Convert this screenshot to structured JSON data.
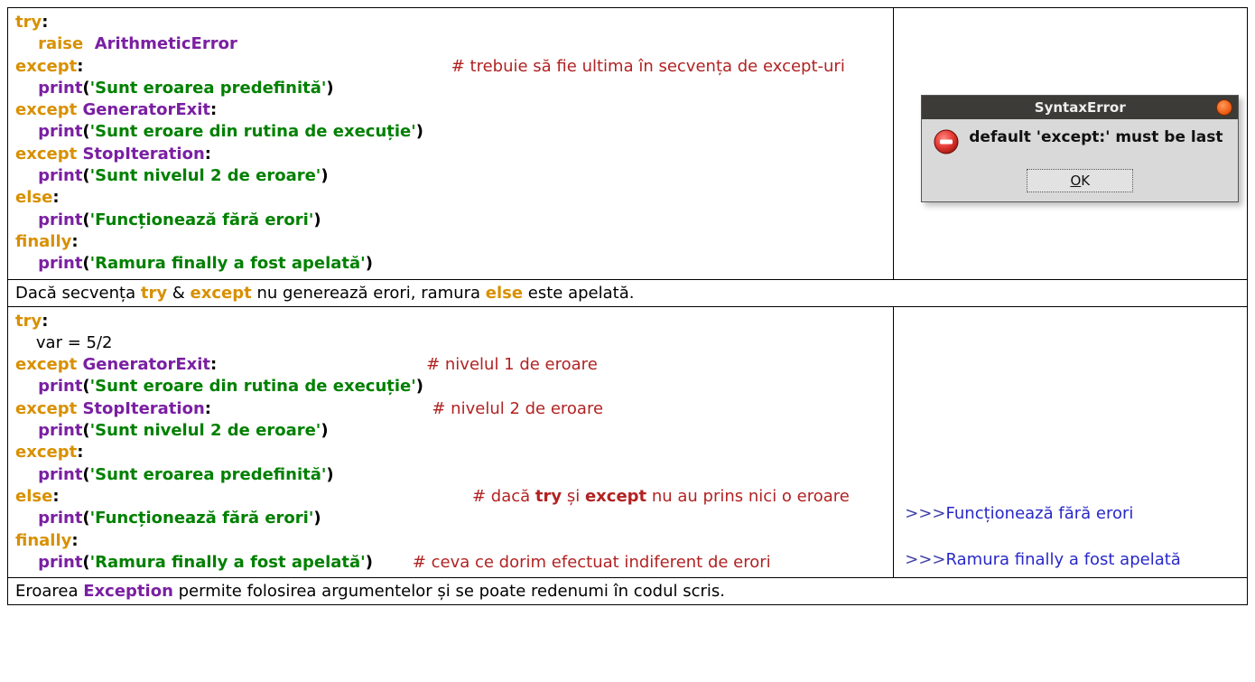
{
  "block1": {
    "l1a": "try",
    "l1b": ":",
    "l2a": "    raise  ",
    "l2b": "ArithmeticError",
    "l3a": "except",
    "l3b": ":",
    "l3pad": "                                                                 ",
    "l3c": "# trebuie să fie ultima în secvența de except-uri",
    "l4a": "    print",
    "l4b": "(",
    "l4c": "'Sunt eroarea predefinită'",
    "l4d": ")",
    "l5a": "except ",
    "l5b": "GeneratorExit",
    "l5c": ":",
    "l6a": "    print",
    "l6b": "(",
    "l6c": "'Sunt eroare din rutina de execuție'",
    "l6d": ")",
    "l7a": "except ",
    "l7b": "StopIteration",
    "l7c": ":",
    "l8a": "    print",
    "l8b": "(",
    "l8c": "'Sunt nivelul 2 de eroare'",
    "l8d": ")",
    "l9a": "else",
    "l9b": ":",
    "l10a": "    print",
    "l10b": "(",
    "l10c": "'Funcționează fără erori'",
    "l10d": ")",
    "l11a": "finally",
    "l11b": ":",
    "l12a": "    print",
    "l12b": "(",
    "l12c": "'Ramura finally a fost apelată'",
    "l12d": ")"
  },
  "dialog": {
    "title": "SyntaxError",
    "message": "default 'except:' must be last",
    "ok_prefix": "O",
    "ok_rest": "K"
  },
  "explain1": {
    "t1": "Dacă secvența ",
    "kw1": "try",
    "t2": " & ",
    "kw2": "except",
    "t3": " nu generează erori, ramura ",
    "kw3": "else",
    "t4": " este apelată."
  },
  "block2": {
    "l1a": "try",
    "l1b": ":",
    "l2a": "    var = 5/2",
    "l3a": "except ",
    "l3b": "GeneratorExit",
    "l3c": ":",
    "l3pad": "                                     ",
    "l3d": "# nivelul 1 de eroare",
    "l4a": "    print",
    "l4b": "(",
    "l4c": "'Sunt eroare din rutina de execuție'",
    "l4d": ")",
    "l5a": "except ",
    "l5b": "StopIteration",
    "l5c": ":",
    "l5pad": "                                       ",
    "l5d": "# nivelul 2 de eroare",
    "l6a": "    print",
    "l6b": "(",
    "l6c": "'Sunt nivelul 2 de eroare'",
    "l6d": ")",
    "l7a": "except",
    "l7b": ":",
    "l8a": "    print",
    "l8b": "(",
    "l8c": "'Sunt eroarea predefinită'",
    "l8d": ")",
    "l9a": "else",
    "l9b": ":",
    "l9pad": "                                                                         ",
    "l9c1": "# dacă ",
    "l9c2": "try",
    "l9c3": " și ",
    "l9c4": "except",
    "l9c5": " nu au prins nici o eroare",
    "l10a": "    print",
    "l10b": "(",
    "l10c": "'Funcționează fără erori'",
    "l10d": ")",
    "l11a": "finally",
    "l11b": ":",
    "l12a": "    print",
    "l12b": "(",
    "l12c": "'Ramura finally a fost apelată'",
    "l12d": ")",
    "l12pad": "       ",
    "l12e": "# ceva ce dorim efectuat indiferent de erori"
  },
  "output2": {
    "p1": ">>>",
    "t1": "Funcționează fără erori",
    "p2": ">>>",
    "t2": "Ramura finally a fost apelată"
  },
  "explain2": {
    "t1": "Eroarea ",
    "kw1": "Exception",
    "t2": " permite folosirea argumentelor și se poate redenumi în codul scris."
  }
}
